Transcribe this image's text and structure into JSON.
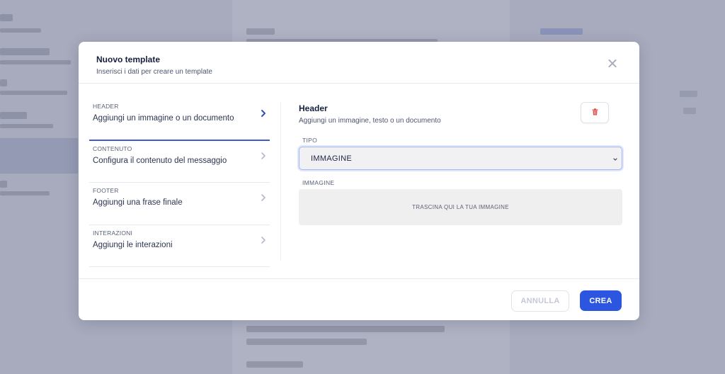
{
  "modal": {
    "title": "Nuovo template",
    "subtitle": "Inserisci i dati per creare un template"
  },
  "steps": [
    {
      "caption": "HEADER",
      "label": "Aggiungi un immagine o un documento",
      "active": true
    },
    {
      "caption": "CONTENUTO",
      "label": "Configura il contenuto del messaggio",
      "active": false
    },
    {
      "caption": "FOOTER",
      "label": "Aggiungi una frase finale",
      "active": false
    },
    {
      "caption": "INTERAZIONI",
      "label": "Aggiungi le interazioni",
      "active": false
    }
  ],
  "panel": {
    "title": "Header",
    "subtitle": "Aggiungi un immagine, testo o un documento",
    "type_label": "TIPO",
    "type_value": "IMMAGINE",
    "image_label": "IMMAGINE",
    "dropzone_text": "TRASCINA QUI LA TUA IMMAGINE"
  },
  "footer": {
    "cancel_label": "ANNULLA",
    "create_label": "CREA"
  },
  "colors": {
    "accent": "#2c56e0",
    "delete_icon": "#e0463f",
    "active_chevron": "#2f4fbf",
    "inactive_chevron": "#b4b9c8"
  },
  "icons": {
    "close": "close-icon",
    "delete": "trash-icon",
    "step_chevron": "chevron-right-icon",
    "select_caret": "chevron-down-icon"
  }
}
